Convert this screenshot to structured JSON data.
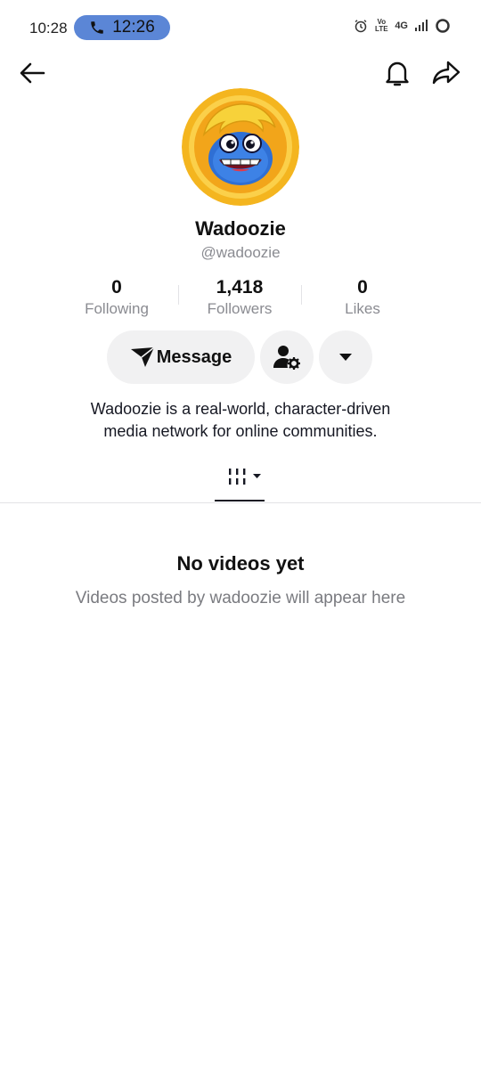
{
  "status_bar": {
    "time": "10:28",
    "call_timer": "12:26",
    "icons": [
      "phone-icon",
      "alarm-icon",
      "volte-icon",
      "network-4g-icon",
      "signal-icon",
      "battery-ring-icon"
    ],
    "network_label": "4G",
    "volte_label": "Vo LTE"
  },
  "nav": {
    "icons": [
      "back-arrow-icon",
      "bell-icon",
      "share-icon"
    ]
  },
  "profile": {
    "avatar_icon": "monster-mascot-avatar",
    "name": "Wadoozie",
    "handle": "@wadoozie",
    "stats": [
      {
        "value": "0",
        "label": "Following"
      },
      {
        "value": "1,418",
        "label": "Followers"
      },
      {
        "value": "0",
        "label": "Likes"
      }
    ],
    "message_label": "Message",
    "bio_line1": "Wadoozie is a real-world, character-driven",
    "bio_line2": "media network for online communities."
  },
  "tabs": {
    "icons": [
      "videos-grid-icon",
      "dropdown-caret-icon"
    ]
  },
  "empty_state": {
    "title": "No videos yet",
    "subtitle": "Videos posted by wadoozie will appear here"
  },
  "colors": {
    "call_pill": "#5b86d6",
    "button_bg": "#f1f1f2",
    "muted_text": "#8a8b91",
    "avatar_ring": "#f4b51f"
  }
}
